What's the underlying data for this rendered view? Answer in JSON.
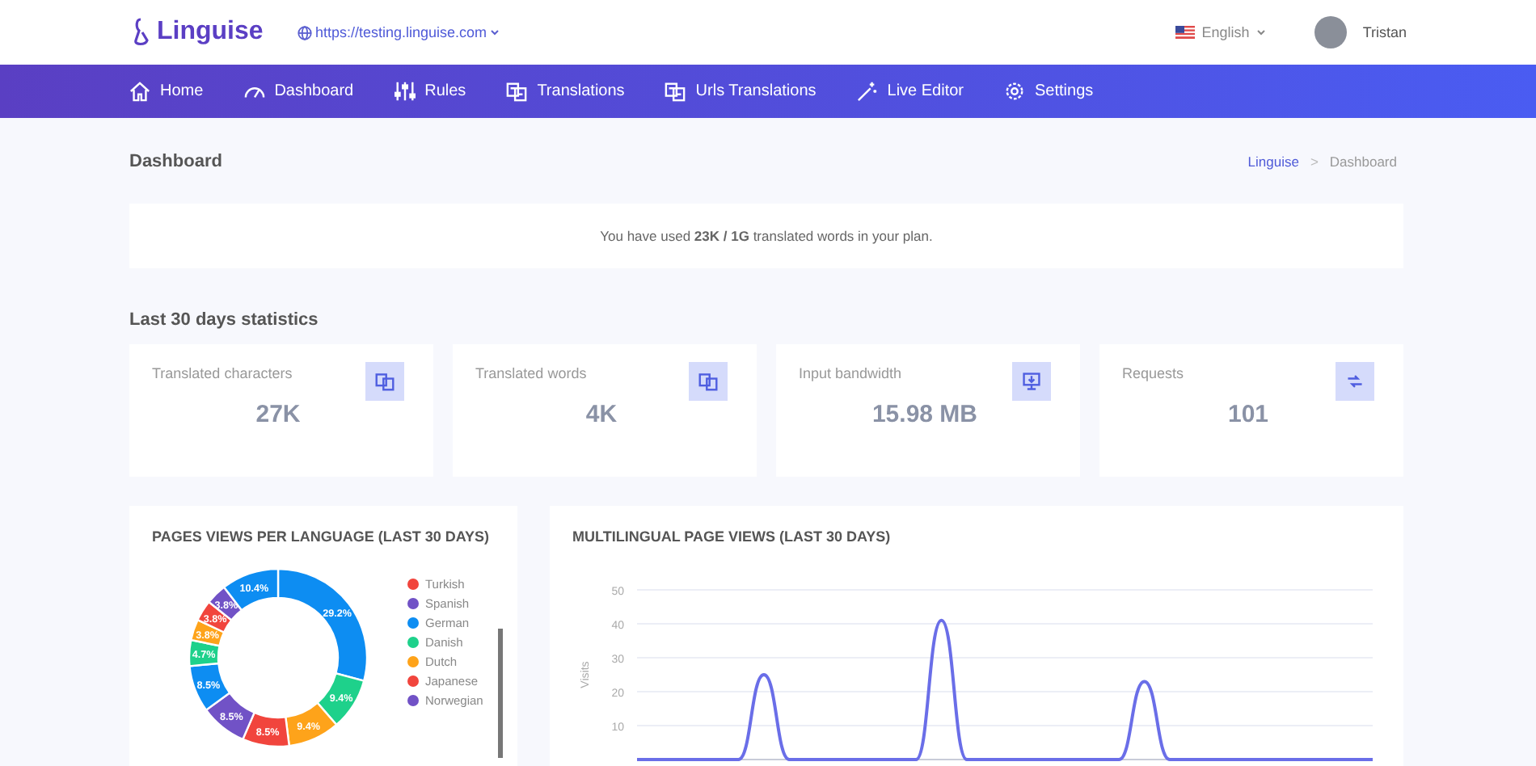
{
  "header": {
    "logo": "Linguise",
    "site_url": "https://testing.linguise.com",
    "language": "English",
    "user": "Tristan"
  },
  "nav": [
    {
      "label": "Home"
    },
    {
      "label": "Dashboard"
    },
    {
      "label": "Rules"
    },
    {
      "label": "Translations"
    },
    {
      "label": "Urls Translations"
    },
    {
      "label": "Live Editor"
    },
    {
      "label": "Settings"
    }
  ],
  "page_title": "Dashboard",
  "breadcrumb": {
    "items": [
      "Linguise",
      "Dashboard"
    ],
    "separator": ">"
  },
  "usage_notice": "You have used **23K / 1G** translated words in your plan.",
  "stats_title": "Last 30 days statistics",
  "stats": [
    {
      "label": "Translated characters",
      "value": "27K"
    },
    {
      "label": "Translated words",
      "value": "4K"
    },
    {
      "label": "Input bandwidth",
      "value": "15.98 MB"
    },
    {
      "label": "Requests",
      "value": "101"
    }
  ],
  "language_chart": {
    "title": "PAGES VIEWS PER LANGUAGE (LAST 30 DAYS)",
    "chart_data": {
      "type": "donut",
      "values": [
        29.2,
        9.4,
        9.4,
        8.5,
        8.5,
        8.5,
        4.7,
        3.8,
        3.8,
        3.8,
        10.4
      ],
      "value_labels": [
        "29.2%",
        "9.4%",
        "9.4%",
        "8.5%",
        "8.5%",
        "8.5%",
        "4.7%",
        "3.8%",
        "3.8%",
        "3.8%",
        "10.4%"
      ]
    },
    "legend": [
      {
        "label": "Turkish",
        "color": "#f1453d"
      },
      {
        "label": "Spanish",
        "color": "#7152c6"
      },
      {
        "label": "German",
        "color": "#0d8df2"
      },
      {
        "label": "Danish",
        "color": "#1ed18b"
      },
      {
        "label": "Dutch",
        "color": "#fea31a"
      },
      {
        "label": "Japanese",
        "color": "#f1453d"
      },
      {
        "label": "Norwegian",
        "color": "#7152c6"
      }
    ]
  },
  "views_chart": {
    "title": "MULTILINGUAL PAGE VIEWS (LAST 30 DAYS)",
    "chart_data": {
      "type": "line",
      "ylabel": "Visits",
      "grid": true,
      "ylim": [
        0,
        50
      ],
      "yticks": [
        10,
        20,
        30,
        40,
        50
      ],
      "series": [
        {
          "color": "#6a6ee8",
          "values": [
            0,
            0,
            0,
            0,
            0,
            25,
            0,
            0,
            0,
            0,
            0,
            0,
            41,
            0,
            0,
            0,
            0,
            0,
            0,
            0,
            23,
            0,
            0,
            0,
            0,
            0,
            0,
            0,
            0,
            0
          ]
        }
      ]
    }
  }
}
